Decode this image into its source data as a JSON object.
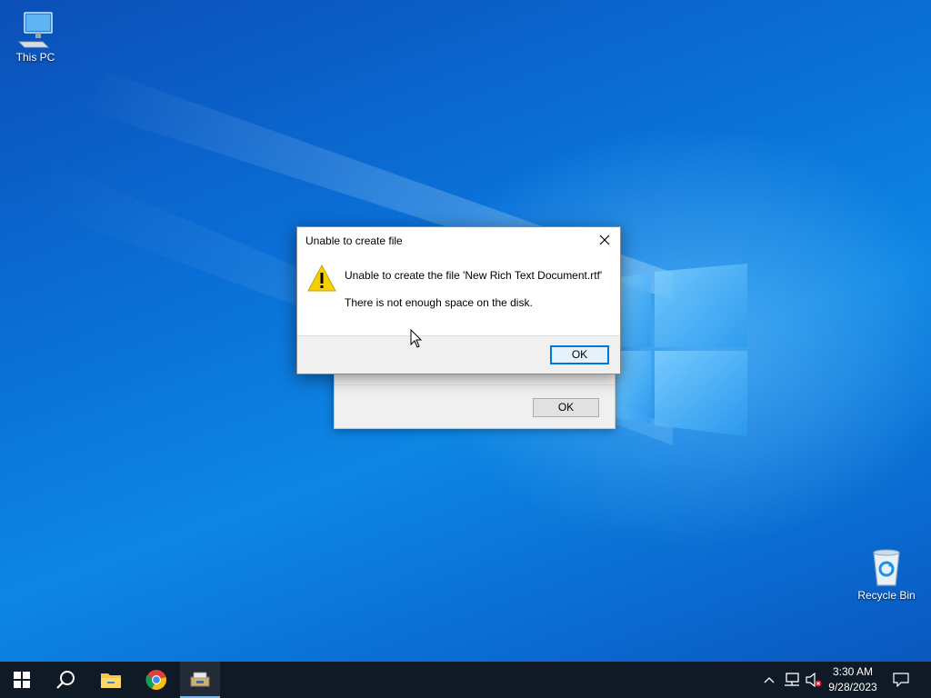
{
  "desktop": {
    "icons": [
      {
        "label": "This PC"
      },
      {
        "label": "Recycle Bin"
      }
    ]
  },
  "dialog": {
    "title": "Unable to create file",
    "message_line1": "Unable to create the file 'New Rich Text Document.rtf'",
    "message_line2": "There is not enough space on the disk.",
    "ok_label": "OK"
  },
  "back_dialog": {
    "ok_label": "OK"
  },
  "taskbar": {
    "time": "3:30 AM",
    "date": "9/28/2023",
    "pinned": [
      "start-icon",
      "search-icon",
      "file-explorer-icon",
      "chrome-icon",
      "installer-app-icon"
    ],
    "tray": [
      "chevron-up-icon",
      "network-icon",
      "volume-muted-icon",
      "notification-icon"
    ]
  },
  "colors": {
    "accent": "#0078d7",
    "taskbar": "#101a26",
    "warning": "#f5d000"
  }
}
